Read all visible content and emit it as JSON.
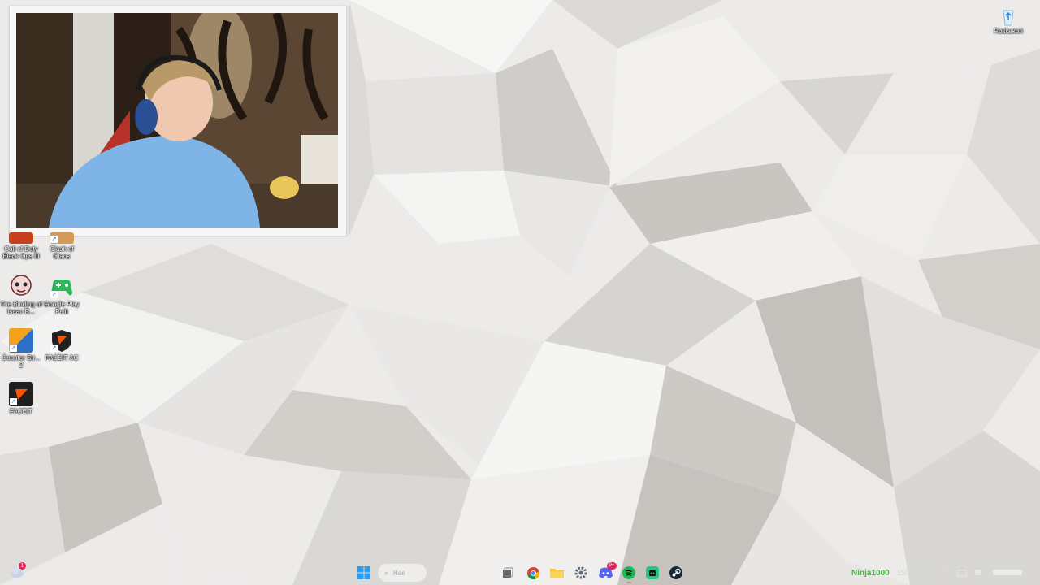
{
  "desktop": {
    "icons": [
      {
        "label": "Call of Duty Black Ops III",
        "icon": "call-of-duty-icon"
      },
      {
        "label": "Clash of Clans",
        "icon": "clash-of-clans-icon"
      },
      {
        "label": "The Binding of Isaac R...",
        "icon": "binding-of-isaac-icon"
      },
      {
        "label": "Google Play Pelit",
        "icon": "google-play-games-icon"
      },
      {
        "label": "Counter Str... 2",
        "icon": "counter-strike-icon"
      },
      {
        "label": "FACEIT AC",
        "icon": "faceit-ac-icon"
      },
      {
        "label": "FACEIT",
        "icon": "faceit-icon"
      }
    ],
    "recycle_bin": {
      "label": "Roskakori",
      "icon": "recycle-bin-icon"
    }
  },
  "webcam": {
    "icon": "webcam-overlay"
  },
  "taskbar": {
    "weather_badge": "1",
    "search_placeholder": "Hae",
    "apps": [
      {
        "name": "start",
        "icon": "windows-start-icon"
      },
      {
        "name": "task-view",
        "icon": "task-view-icon"
      },
      {
        "name": "chrome",
        "icon": "chrome-icon"
      },
      {
        "name": "file-explorer",
        "icon": "folder-icon"
      },
      {
        "name": "settings",
        "icon": "gear-icon"
      },
      {
        "name": "discord",
        "icon": "discord-icon"
      },
      {
        "name": "spotify",
        "icon": "spotify-icon"
      },
      {
        "name": "overlay",
        "icon": "overlay-app-icon"
      },
      {
        "name": "steam",
        "icon": "steam-icon"
      }
    ],
    "discord_badge": "9+",
    "tray_user": "Ninja1000",
    "tray_extra": "1509????"
  },
  "colors": {
    "tray_user": "#3fbf3f",
    "spotify": "#1db954",
    "folder": "#f2c230",
    "accent": "#2b7de9"
  }
}
